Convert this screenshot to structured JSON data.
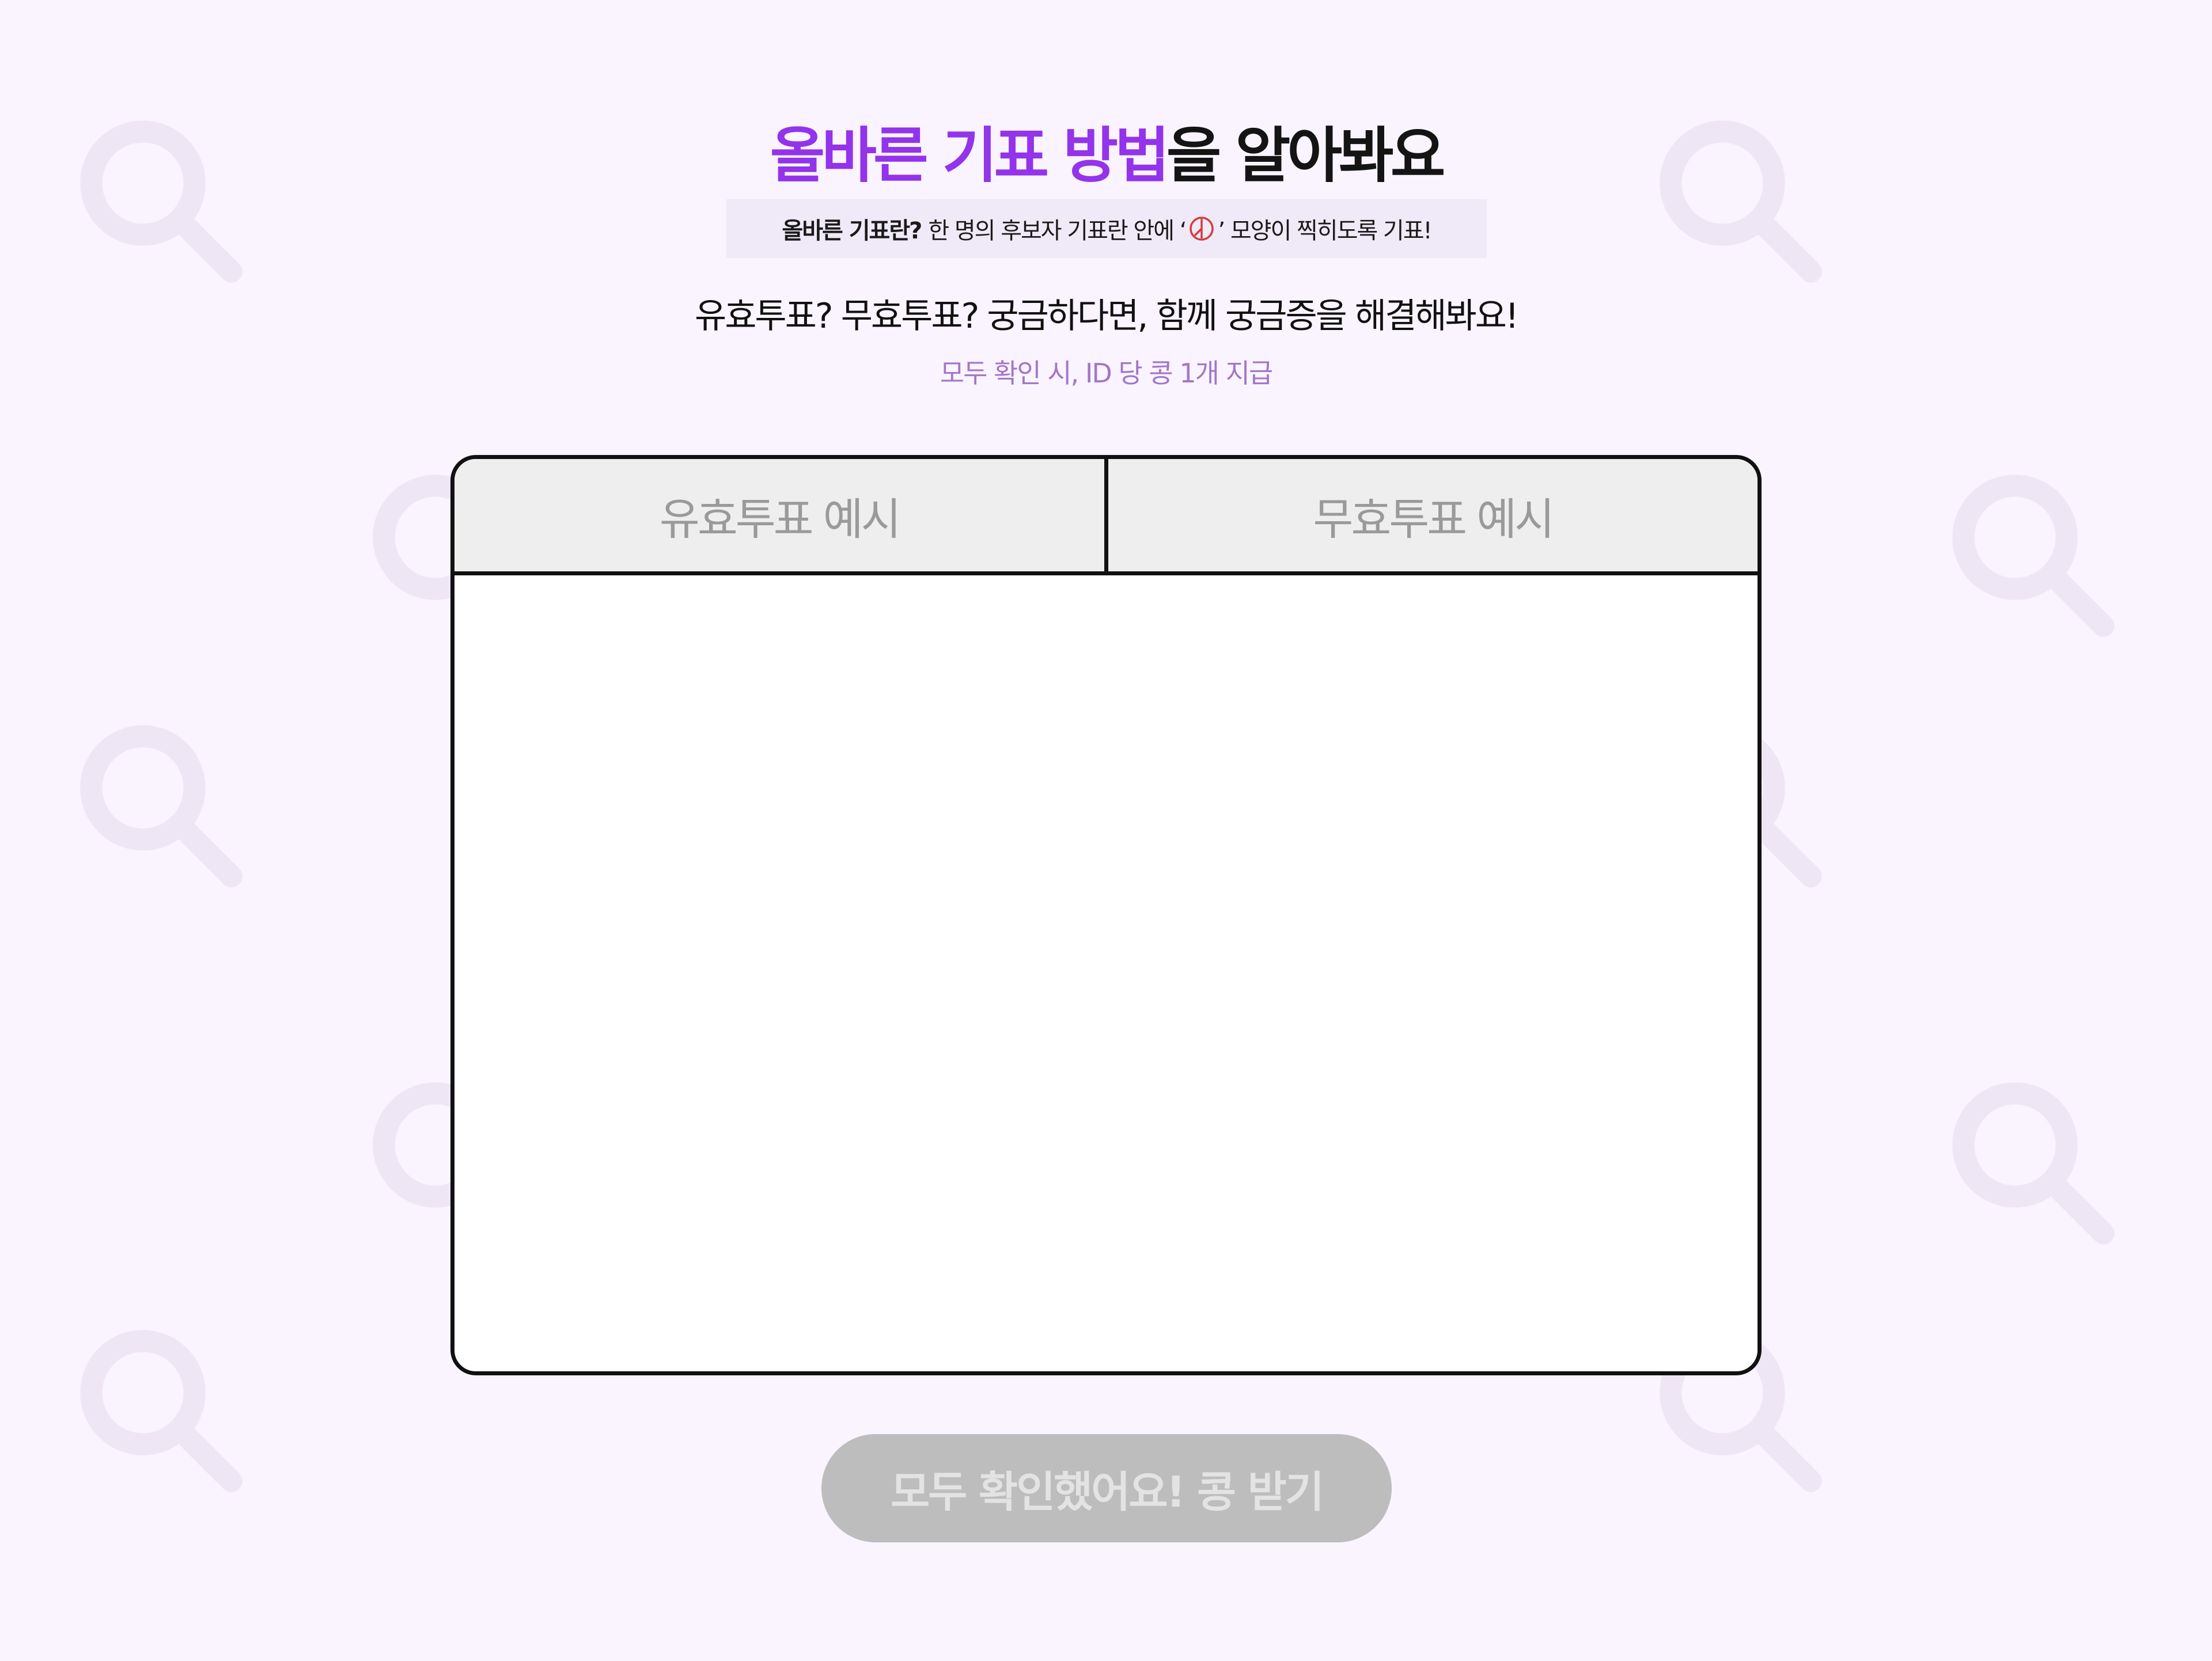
{
  "header": {
    "title_accent": "올바른 기표 방법",
    "title_rest": "을 알아봐요"
  },
  "tip": {
    "lead": "올바른 기표란?",
    "text_before": "한 명의 후보자 기표란 안에 ‘",
    "mark_icon": "ballot-stamp-icon",
    "text_after": "’ 모양이 찍히도록 기표!"
  },
  "question": "유효투표? 무효투표? 궁금하다면, 함께 궁금증을 해결해봐요!",
  "reward_note": "모두 확인 시, ID 당 콩 1개 지급",
  "tabs": [
    {
      "label": "유효투표 예시"
    },
    {
      "label": "무효투표 예시"
    }
  ],
  "claim_button": {
    "label": "모두 확인했어요! 콩 받기"
  },
  "colors": {
    "background": "#f9f4ff",
    "accent": "#9333ea",
    "tip_bg": "#f0e9f7",
    "reward_text": "#a276c9",
    "button_disabled": "#bdbdbd",
    "stamp": "#d63b3b"
  },
  "background_icon": "magnifier-icon"
}
